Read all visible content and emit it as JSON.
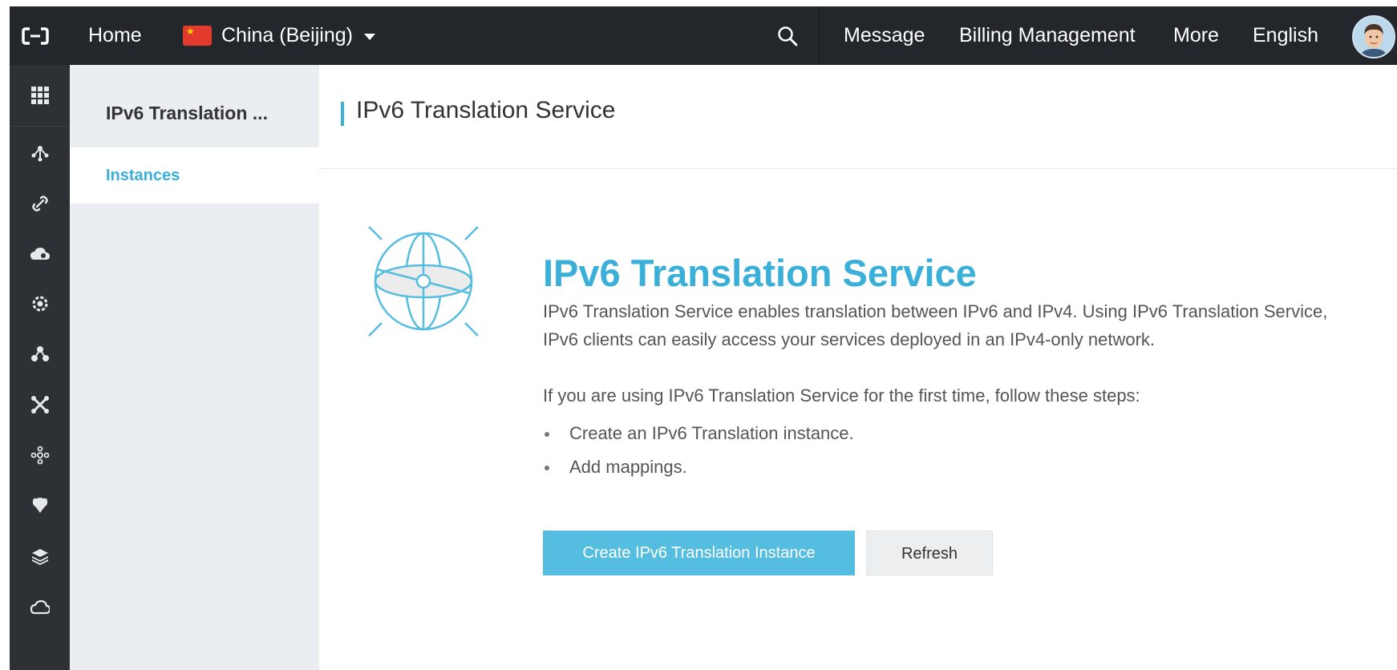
{
  "topbar": {
    "home_label": "Home",
    "region_label": "China (Beijing)",
    "message_label": "Message",
    "billing_label": "Billing Management",
    "more_label": "More",
    "language_label": "English"
  },
  "rail": {
    "icons": [
      "grid-icon",
      "network-icon",
      "link-icon",
      "cloud-icon",
      "gear-cog-icon",
      "cluster-icon",
      "cross-icon",
      "nodes-icon",
      "shield-icon",
      "layers-icon",
      "cloud-partial-icon"
    ]
  },
  "sidebar": {
    "title": "IPv6 Translation ...",
    "items": [
      {
        "label": "Instances",
        "active": true
      }
    ]
  },
  "main": {
    "page_title": "IPv6 Translation Service",
    "hero_title": "IPv6 Translation Service",
    "description": "IPv6 Translation Service enables translation between IPv6 and IPv4. Using IPv6 Translation Service, IPv6 clients can easily access your services deployed in an IPv4-only network.",
    "steps_intro": "If you are using IPv6 Translation Service for the first time, follow these steps:",
    "steps": [
      "Create an IPv6 Translation instance.",
      "Add mappings."
    ],
    "create_button": "Create IPv6 Translation Instance",
    "refresh_button": "Refresh"
  },
  "colors": {
    "accent": "#3ab0d8",
    "topbar_bg": "#23262b",
    "rail_bg": "#2d3035",
    "sidebar_bg": "#eaedf1"
  }
}
